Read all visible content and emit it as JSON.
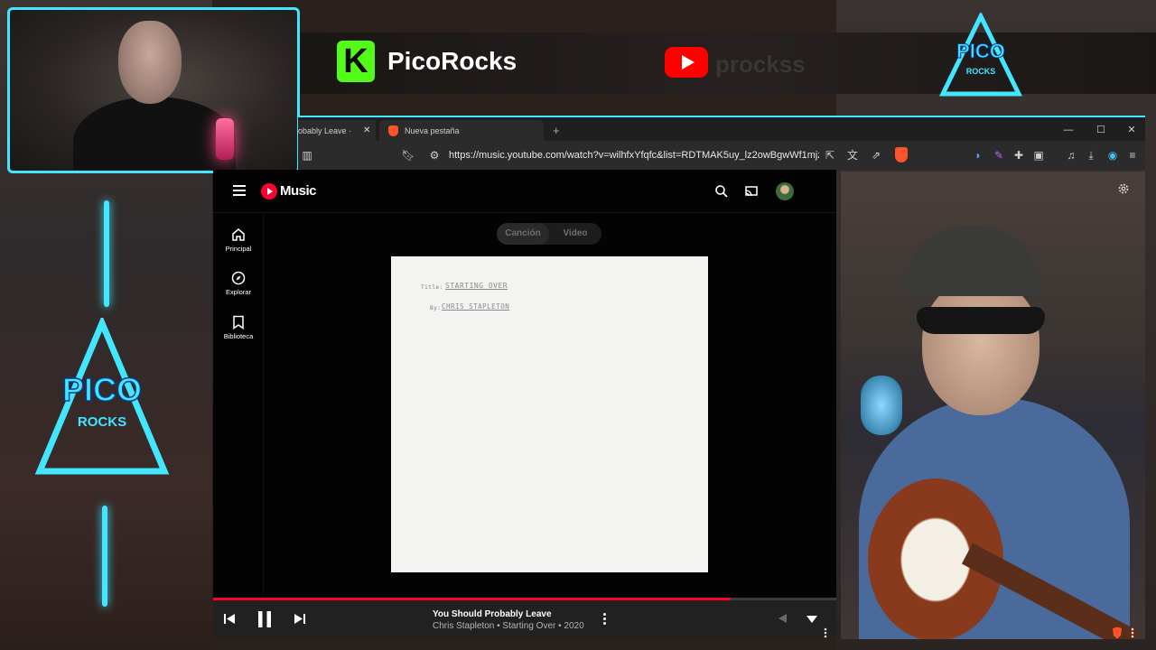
{
  "overlay": {
    "brand_letter": "K",
    "brand_name": "PicoRocks",
    "youtube_handle": "prockss",
    "logo_text_top": "PICO",
    "logo_text_bottom": "ROCKS",
    "accent": "#42e6ff",
    "kick_green": "#53fc18"
  },
  "browser": {
    "tabs": [
      {
        "label": "obably Leave ·"
      },
      {
        "label": "Nueva pestaña"
      }
    ],
    "new_tab_glyph": "+",
    "url": "https://music.youtube.com/watch?v=wilhfxYfqfc&list=RDTMAK5uy_lz2owBgwWf1mjz...",
    "brand_color": "#fb542b"
  },
  "ytmusic": {
    "logo_text": "Music",
    "nav": [
      {
        "label": "Principal",
        "icon": "home-icon"
      },
      {
        "label": "Explorar",
        "icon": "compass-icon"
      },
      {
        "label": "Biblioteca",
        "icon": "library-icon"
      }
    ],
    "toggle": {
      "song": "Canción",
      "video": "Video",
      "selected": "Canción"
    },
    "album_art": {
      "title_label": "Title:",
      "title_value": "STARTING OVER",
      "by_label": "By:",
      "by_value": "CHRIS STAPLETON"
    },
    "player": {
      "title": "You Should Probably Leave",
      "meta": "Chris Stapleton • Starting Over • 2020",
      "progress": 0.83,
      "state": "playing"
    },
    "accent": "#ff0033"
  }
}
